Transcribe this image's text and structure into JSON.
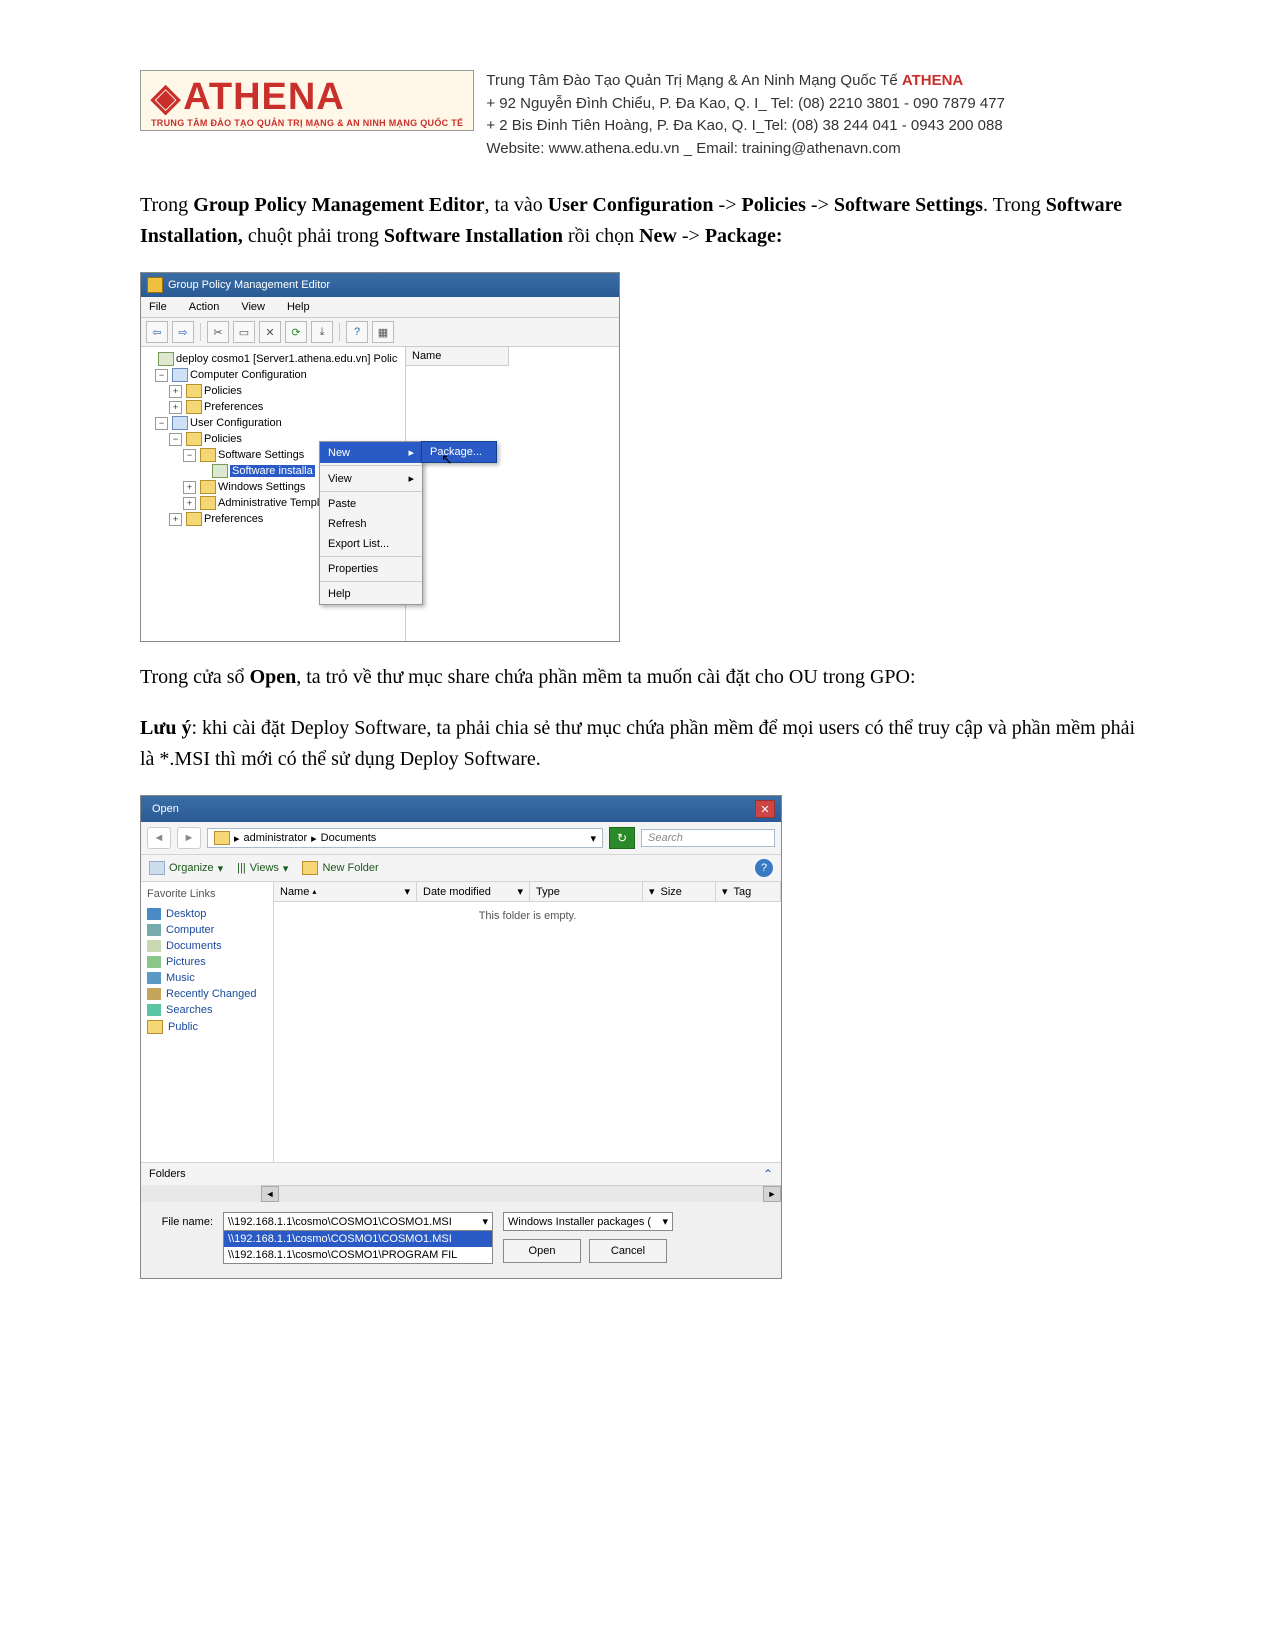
{
  "header": {
    "logo": "ATHENA",
    "logo_sub": "TRUNG TÂM ĐÀO TẠO QUẢN TRỊ MẠNG & AN NINH MẠNG QUỐC TẾ",
    "line1_a": "Trung Tâm Đào Tạo Quản Trị Mạng & An Ninh Mạng Quốc Tế ",
    "line1_b": "ATHENA",
    "line2": "+  92 Nguyễn Đình Chiểu, P. Đa Kao, Q. I_ Tel: (08) 2210 3801 -  090 7879 477",
    "line3": "+  2 Bis Đinh Tiên Hoàng, P. Đa Kao, Q. I_Tel: (08) 38 244 041 - 0943 200 088",
    "line4": "Website: www.athena.edu.vn     _       Email: training@athenavn.com"
  },
  "para1": {
    "t1": "Trong ",
    "b1": "Group Policy Management Editor",
    "t2": ", ta vào ",
    "b2": "User Configuration",
    "t3": " -> ",
    "b3": "Policies",
    "t4": " -> ",
    "b4": "Software Settings",
    "t5": ". Trong ",
    "b5": "Software Installation,",
    "t6": " chuột phải trong ",
    "b6": "Software Installation",
    "t7": " rồi chọn ",
    "b7": "New",
    "t8": " -> ",
    "b8": "Package:"
  },
  "gpme": {
    "title": "Group Policy Management Editor",
    "menu": [
      "File",
      "Action",
      "View",
      "Help"
    ],
    "col_name": "Name",
    "tree": {
      "root": "deploy cosmo1 [Server1.athena.edu.vn] Polic",
      "cc": "Computer Configuration",
      "cc_policies": "Policies",
      "cc_prefs": "Preferences",
      "uc": "User Configuration",
      "uc_policies": "Policies",
      "ss": "Software Settings",
      "si": "Software installa",
      "ws": "Windows Settings",
      "at": "Administrative Templa",
      "uc_prefs": "Preferences"
    },
    "ctx": {
      "new": "New",
      "view": "View",
      "paste": "Paste",
      "refresh": "Refresh",
      "export": "Export List...",
      "props": "Properties",
      "help": "Help"
    },
    "sub": {
      "package": "Package..."
    }
  },
  "para2": {
    "t1": "Trong cửa sổ ",
    "b1": "Open",
    "t2": ", ta trỏ về thư mục share chứa phần mềm ta muốn cài đặt cho OU trong GPO:"
  },
  "para3": {
    "b1": "Lưu ý",
    "t1": ": khi cài đặt Deploy Software, ta phải chia sẻ thư mục chứa phần mềm để mọi users có thể truy cập và phần mềm phải là *.MSI thì mới có thể sử dụng Deploy Software."
  },
  "open": {
    "title": "Open",
    "addr_parts": [
      "",
      "administrator",
      "Documents"
    ],
    "search": "Search",
    "organize": "Organize",
    "views": "Views",
    "newfolder": "New Folder",
    "fav_hdr": "Favorite Links",
    "favs": [
      "Desktop",
      "Computer",
      "Documents",
      "Pictures",
      "Music",
      "Recently Changed",
      "Searches",
      "Public"
    ],
    "cols": {
      "name": "Name",
      "date": "Date modified",
      "type": "Type",
      "size": "Size",
      "tag": "Tag"
    },
    "empty": "This folder is empty.",
    "folders": "Folders",
    "filename_label": "File name:",
    "filename_value": "\\\\192.168.1.1\\cosmo\\COSMO1\\COSMO1.MSI",
    "filename_opts": [
      "\\\\192.168.1.1\\cosmo\\COSMO1\\COSMO1.MSI",
      "\\\\192.168.1.1\\cosmo\\COSMO1\\PROGRAM FIL"
    ],
    "filetype": "Windows Installer packages (",
    "open_btn": "Open",
    "cancel_btn": "Cancel"
  }
}
